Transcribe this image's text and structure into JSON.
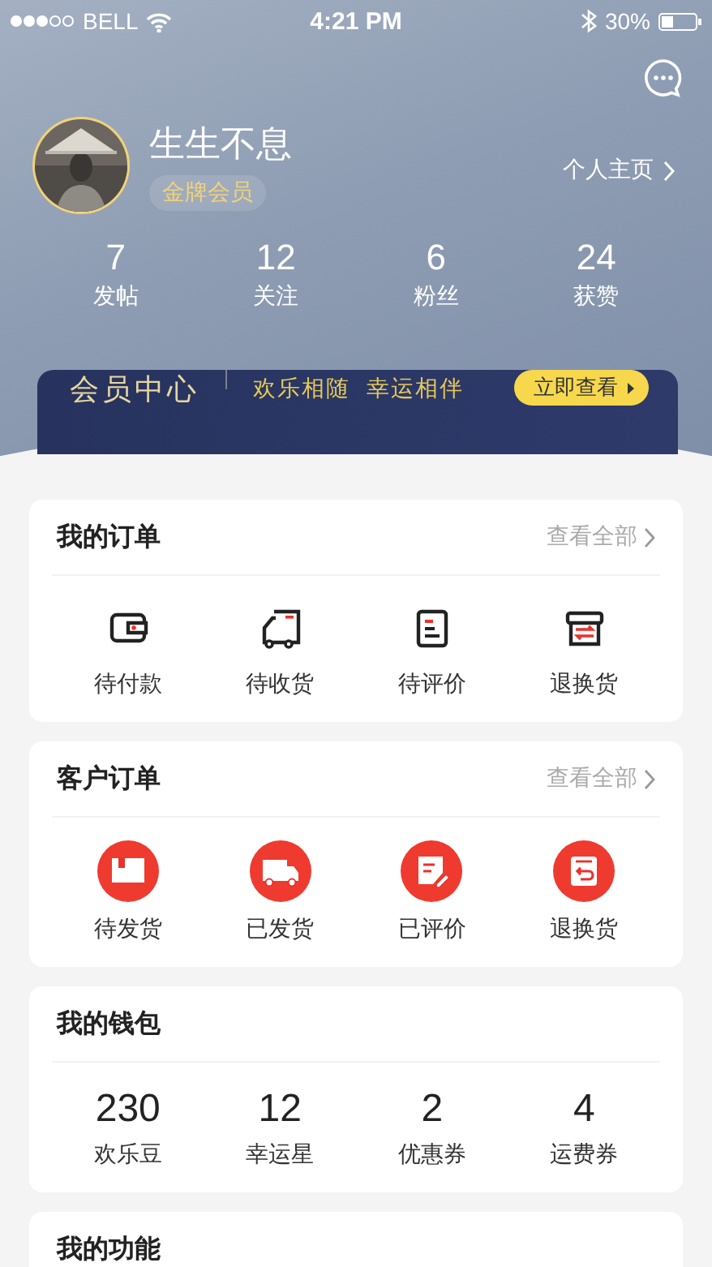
{
  "status_bar": {
    "carrier": "BELL",
    "time": "4:21 PM",
    "battery": "30%"
  },
  "profile": {
    "name": "生生不息",
    "badge": "金牌会员",
    "homepage_link": "个人主页",
    "stats": [
      {
        "value": "7",
        "label": "发帖"
      },
      {
        "value": "12",
        "label": "关注"
      },
      {
        "value": "6",
        "label": "粉丝"
      },
      {
        "value": "24",
        "label": "获赞"
      }
    ]
  },
  "member_banner": {
    "title": "会员中心",
    "slogans": [
      "欢乐相随",
      "幸运相伴"
    ],
    "button": "立即查看"
  },
  "sections": [
    {
      "kind": "orders",
      "title": "我的订单",
      "more": "查看全部",
      "items": [
        {
          "kind": "wallet",
          "label": "待付款"
        },
        {
          "kind": "truck",
          "label": "待收货"
        },
        {
          "kind": "review",
          "label": "待评价"
        },
        {
          "kind": "return",
          "label": "退换货"
        }
      ]
    },
    {
      "kind": "sales",
      "title": "客户订单",
      "more": "查看全部",
      "items": [
        {
          "kind": "parcel",
          "label": "待发货"
        },
        {
          "kind": "truck",
          "label": "已发货"
        },
        {
          "kind": "review",
          "label": "已评价"
        },
        {
          "kind": "return",
          "label": "退换货"
        }
      ]
    },
    {
      "kind": "wallet",
      "title": "我的钱包",
      "items": [
        {
          "value": "230",
          "label": "欢乐豆"
        },
        {
          "value": "12",
          "label": "幸运星"
        },
        {
          "value": "2",
          "label": "优惠券"
        },
        {
          "value": "4",
          "label": "运费券"
        }
      ]
    },
    {
      "kind": "plain",
      "title": "我的功能"
    }
  ]
}
